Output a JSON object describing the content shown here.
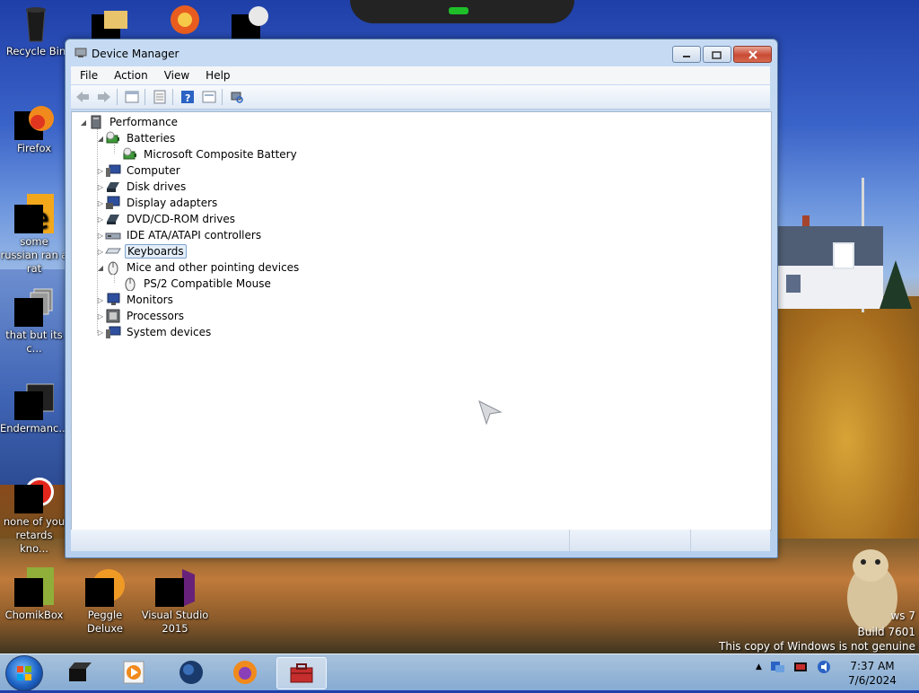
{
  "desktop": {
    "icons": [
      {
        "label": "Recycle Bin"
      },
      {
        "label": "Firefox"
      },
      {
        "label": "some russian ran a rat"
      },
      {
        "label": "that but its c..."
      },
      {
        "label": "Endermanc..."
      },
      {
        "label": "none of you retards kno..."
      },
      {
        "label": "ChomikBox"
      },
      {
        "label": "Peggle Deluxe"
      },
      {
        "label": "Visual Studio 2015"
      }
    ],
    "watermark": {
      "line1": "ws 7",
      "line2": "Build 7601",
      "line3": "This copy of Windows is not genuine"
    }
  },
  "window": {
    "title": "Device Manager",
    "menu": [
      "File",
      "Action",
      "View",
      "Help"
    ],
    "toolbar_icons": [
      "back-icon",
      "forward-icon",
      "properties-icon",
      "list-icon",
      "help-icon",
      "update-icon",
      "scan-hardware-icon"
    ]
  },
  "tree": {
    "root": "Performance",
    "nodes": [
      {
        "label": "Batteries",
        "expanded": true,
        "icon": "battery-icon"
      },
      {
        "label": "Microsoft Composite Battery",
        "child": true,
        "icon": "battery-icon"
      },
      {
        "label": "Computer",
        "icon": "computer-icon"
      },
      {
        "label": "Disk drives",
        "icon": "disk-drive-icon"
      },
      {
        "label": "Display adapters",
        "icon": "display-adapter-icon"
      },
      {
        "label": "DVD/CD-ROM drives",
        "icon": "dvd-drive-icon"
      },
      {
        "label": "IDE ATA/ATAPI controllers",
        "icon": "ide-controller-icon"
      },
      {
        "label": "Keyboards",
        "selected": true,
        "icon": "keyboard-icon"
      },
      {
        "label": "Mice and other pointing devices",
        "expanded": true,
        "icon": "mouse-icon"
      },
      {
        "label": "PS/2 Compatible Mouse",
        "child": true,
        "icon": "mouse-icon"
      },
      {
        "label": "Monitors",
        "icon": "monitor-icon"
      },
      {
        "label": "Processors",
        "icon": "processor-icon"
      },
      {
        "label": "System devices",
        "icon": "system-devices-icon"
      }
    ]
  },
  "taskbar": {
    "apps": [
      "terminal-app",
      "media-player-app",
      "globe-app",
      "firefox-app",
      "device-manager-app"
    ],
    "clock_time": "7:37 AM",
    "clock_date": "7/6/2024"
  }
}
